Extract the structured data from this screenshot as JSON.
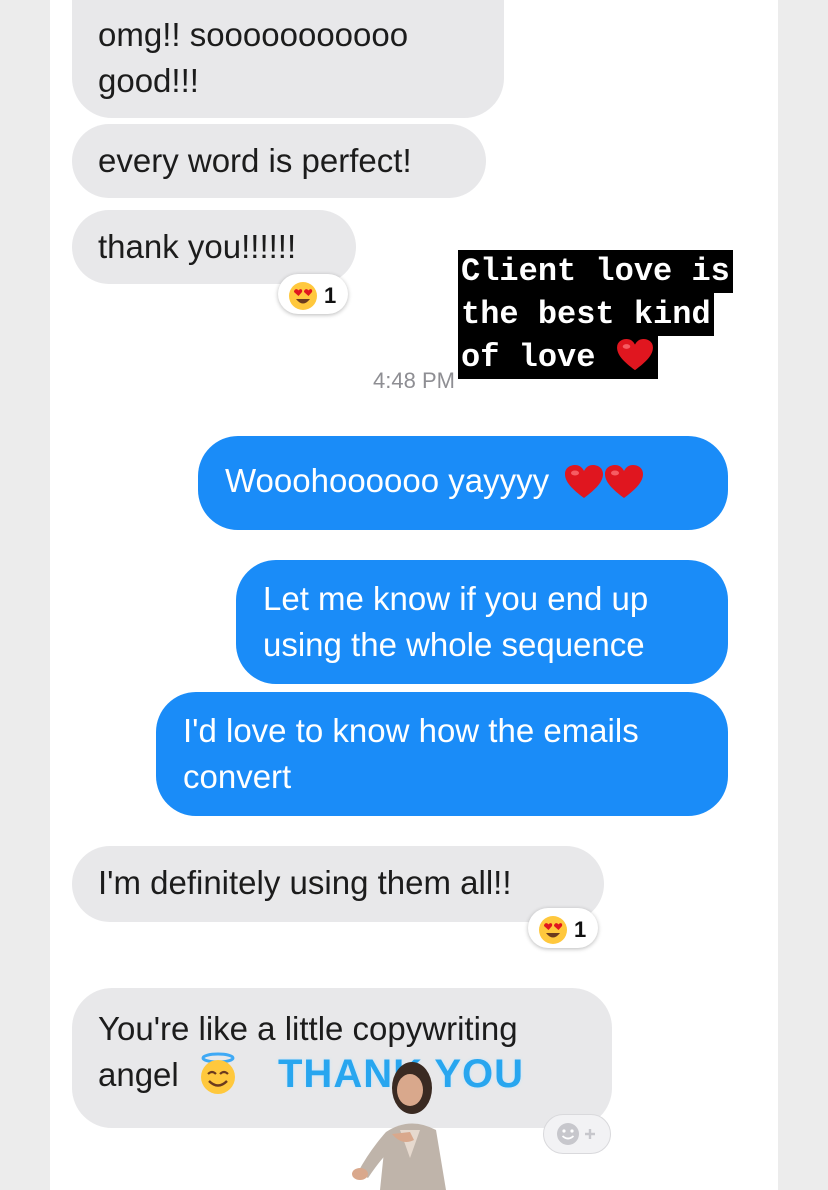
{
  "messages": {
    "m1": {
      "text": "omg!! sooooooooooo good!!!"
    },
    "m2": {
      "text": "every word is perfect!"
    },
    "m3": {
      "text": "thank you!!!!!!",
      "reaction_emoji": "heart-eyes",
      "reaction_count": "1"
    },
    "timestamp": "4:48 PM",
    "m4": {
      "text": "Wooohoooooo yayyyy",
      "emoji": "red-heart x2"
    },
    "m5": {
      "text": "Let me know if you end up using the whole sequence"
    },
    "m6": {
      "text": "I'd love to know how the emails convert"
    },
    "m7": {
      "text": "I'm definitely using them all!!",
      "reaction_emoji": "heart-eyes",
      "reaction_count": "1"
    },
    "m8": {
      "text": "You're like a little copywriting angel",
      "emoji": "smiling-face-with-halo"
    }
  },
  "story_overlay": {
    "caption_lines": [
      "Client love is",
      "the best kind",
      "of love"
    ],
    "caption_emoji": "red-heart",
    "sticker_text": "THANK YOU"
  },
  "colors": {
    "incoming_bubble": "#e8e8ea",
    "outgoing_bubble": "#1a8cf8",
    "timestamp": "#8e8e93",
    "sticker_text": "#28a6ef"
  },
  "icons": [
    "heart-eyes-icon",
    "red-heart-icon",
    "halo-face-icon",
    "add-reaction-icon"
  ]
}
